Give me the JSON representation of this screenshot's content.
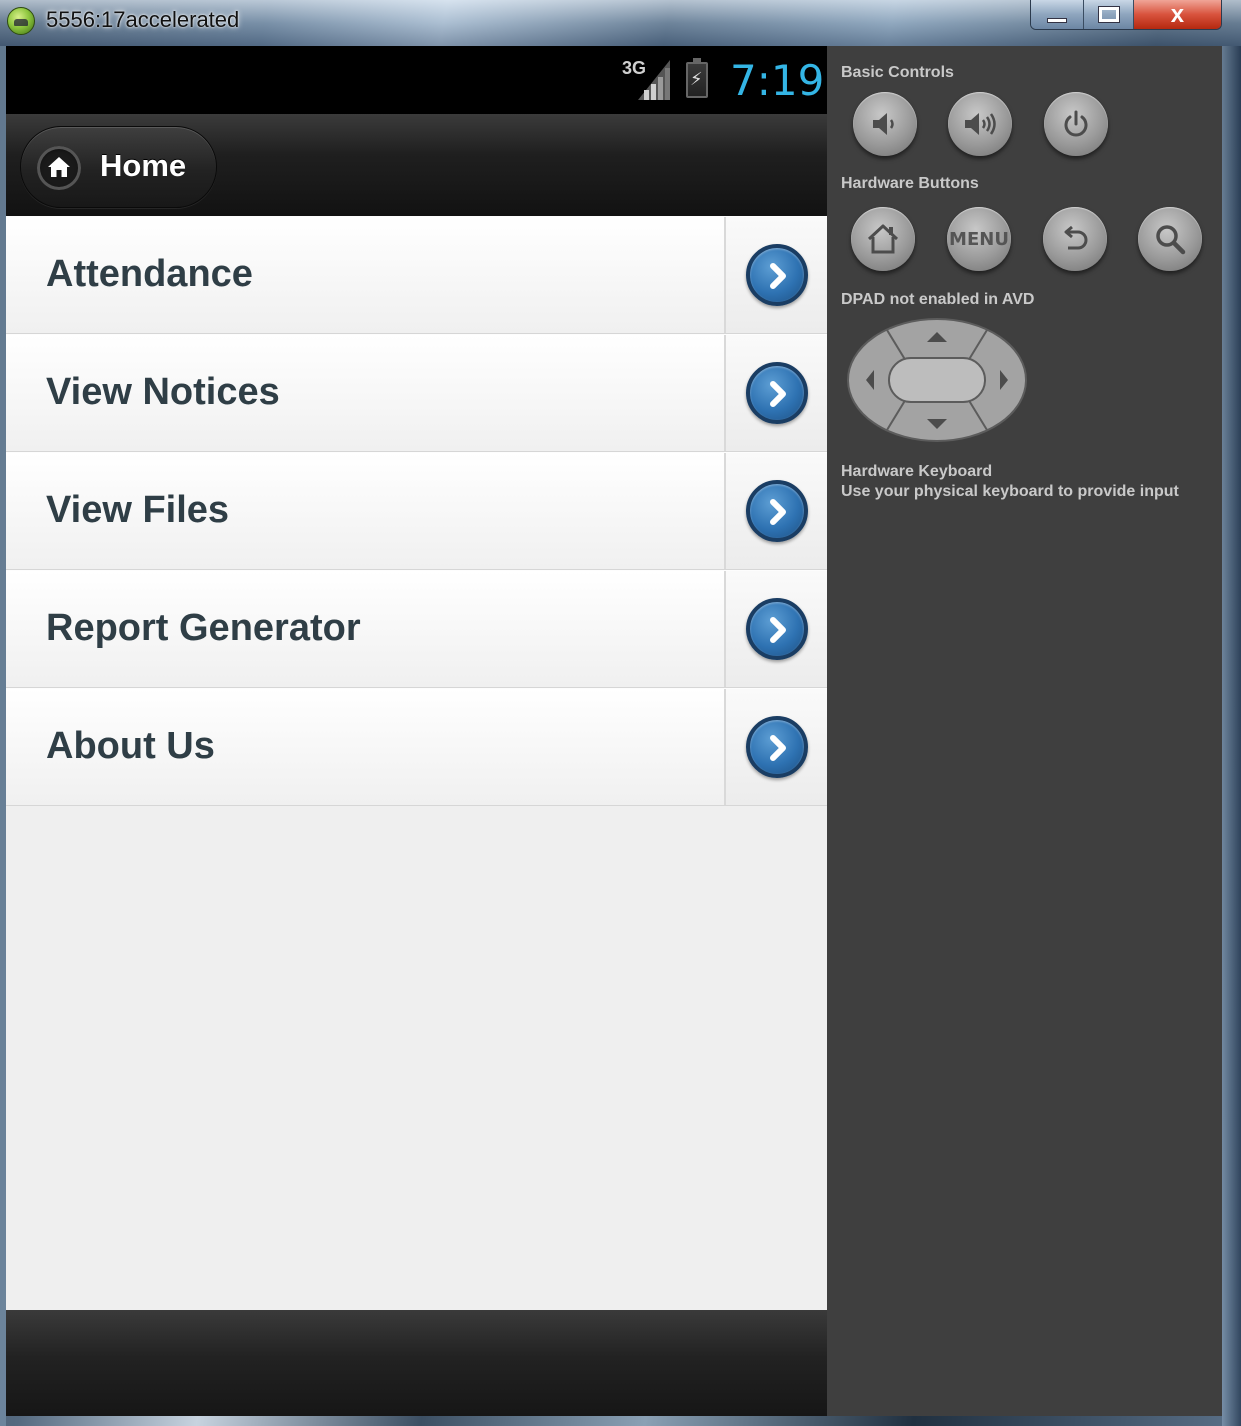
{
  "window": {
    "title": "5556:17accelerated",
    "close_glyph": "x"
  },
  "statusbar": {
    "network": "3G",
    "battery_glyph": "⚡",
    "time": "7:19",
    "clock_color": "#34b5e5"
  },
  "header": {
    "home_label": "Home",
    "home_icon": "home-icon"
  },
  "menu": {
    "items": [
      {
        "label": "Attendance"
      },
      {
        "label": "View Notices"
      },
      {
        "label": "View Files"
      },
      {
        "label": "Report Generator"
      },
      {
        "label": "About Us"
      }
    ],
    "arrow_icon": "chevron-right-icon",
    "accent": "#2e72b2"
  },
  "panel": {
    "basic_controls_title": "Basic Controls",
    "basic_controls": [
      "volume-down-icon",
      "volume-up-icon",
      "power-icon"
    ],
    "hardware_buttons_title": "Hardware Buttons",
    "hardware_buttons": [
      "home-icon",
      "menu-button",
      "back-icon",
      "search-icon"
    ],
    "menu_label": "MENU",
    "dpad_title": "DPAD not enabled in AVD",
    "keyboard_title": "Hardware Keyboard",
    "keyboard_text": "Use your physical keyboard to provide input"
  }
}
